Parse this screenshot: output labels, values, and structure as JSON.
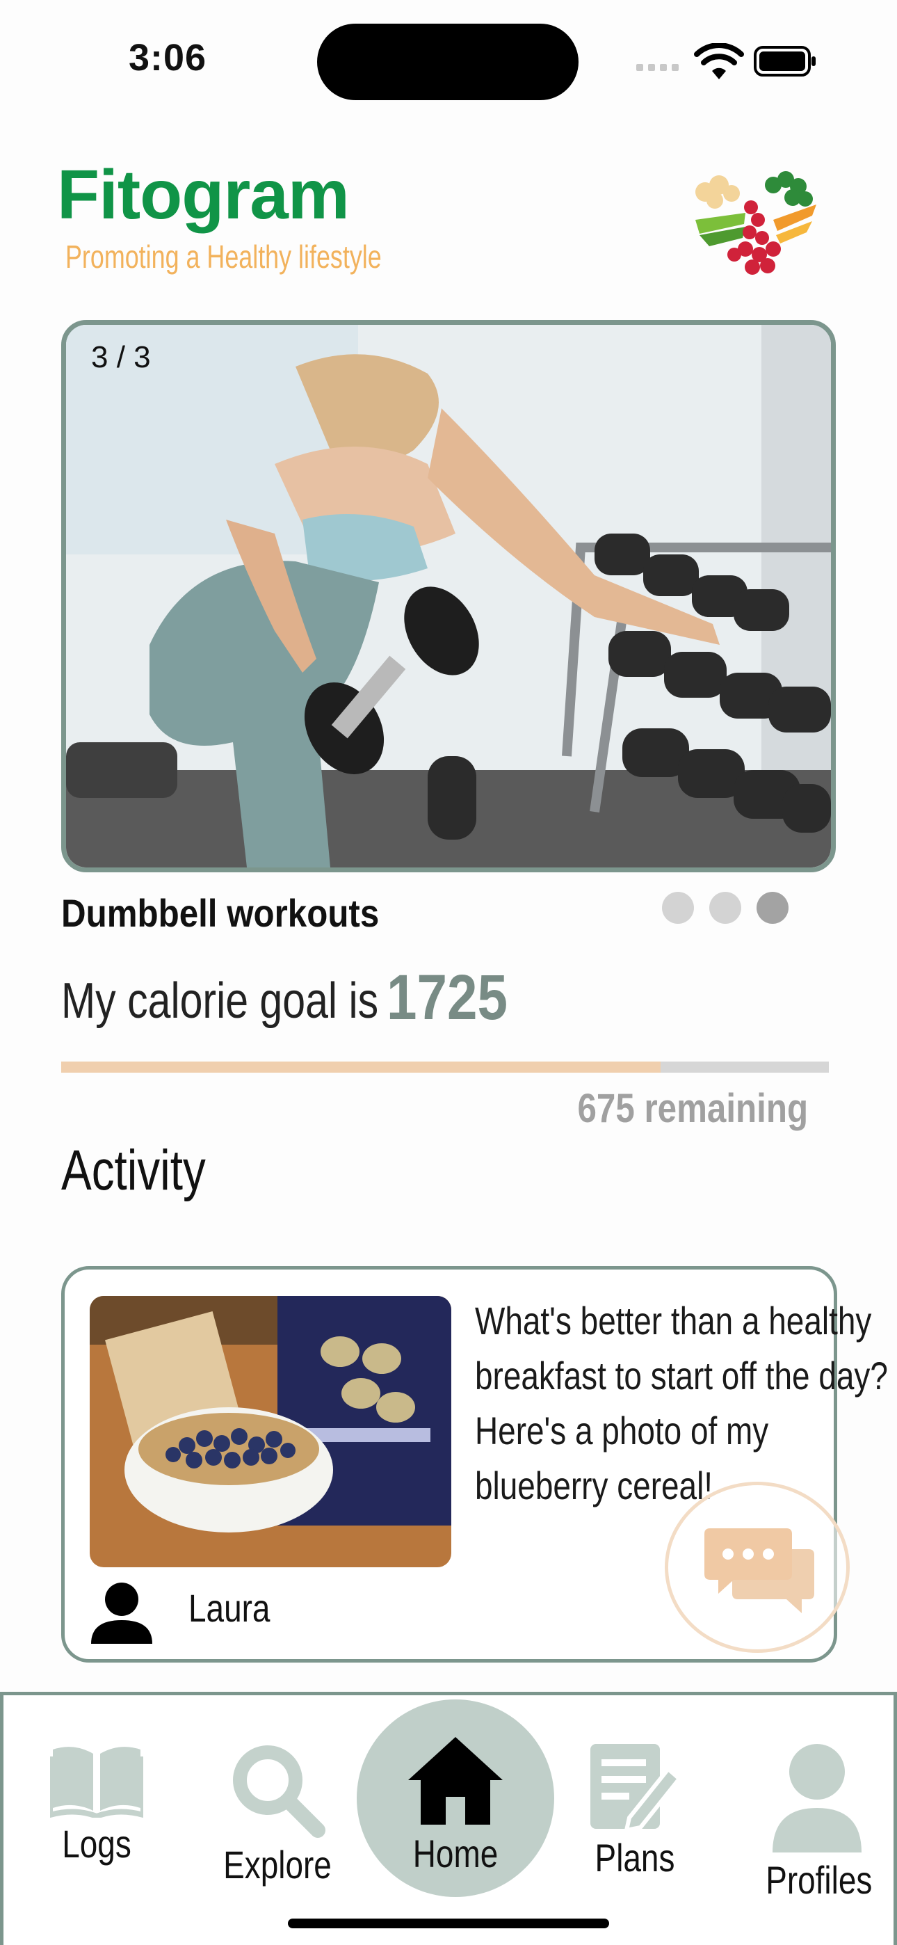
{
  "status_bar": {
    "time": "3:06"
  },
  "header": {
    "brand": "Fitogram",
    "tagline": "Promoting a Healthy lifestyle",
    "logo_icon": "vegetable-heart-logo"
  },
  "carousel": {
    "counter": "3 / 3",
    "caption": "Dumbbell workouts",
    "total_slides": 3,
    "active_slide": 3
  },
  "calorie": {
    "label": "My calorie goal is",
    "value": "1725",
    "remaining": "675 remaining",
    "progress_fraction": 0.781
  },
  "activity": {
    "title": "Activity",
    "post": {
      "text_lines": [
        "What's better than a healthy",
        "breakfast to start off the day?",
        "Here's a photo of my",
        "blueberry cereal!"
      ],
      "author": "Laura"
    }
  },
  "nav": {
    "logs": "Logs",
    "explore": "Explore",
    "home": "Home",
    "plans": "Plans",
    "profiles": "Profiles",
    "active": "home"
  },
  "colors": {
    "brand_green": "#109447",
    "tagline_orange": "#f2b25c",
    "accent_sage": "#7c968d",
    "progress_peach": "#f0cfae"
  }
}
